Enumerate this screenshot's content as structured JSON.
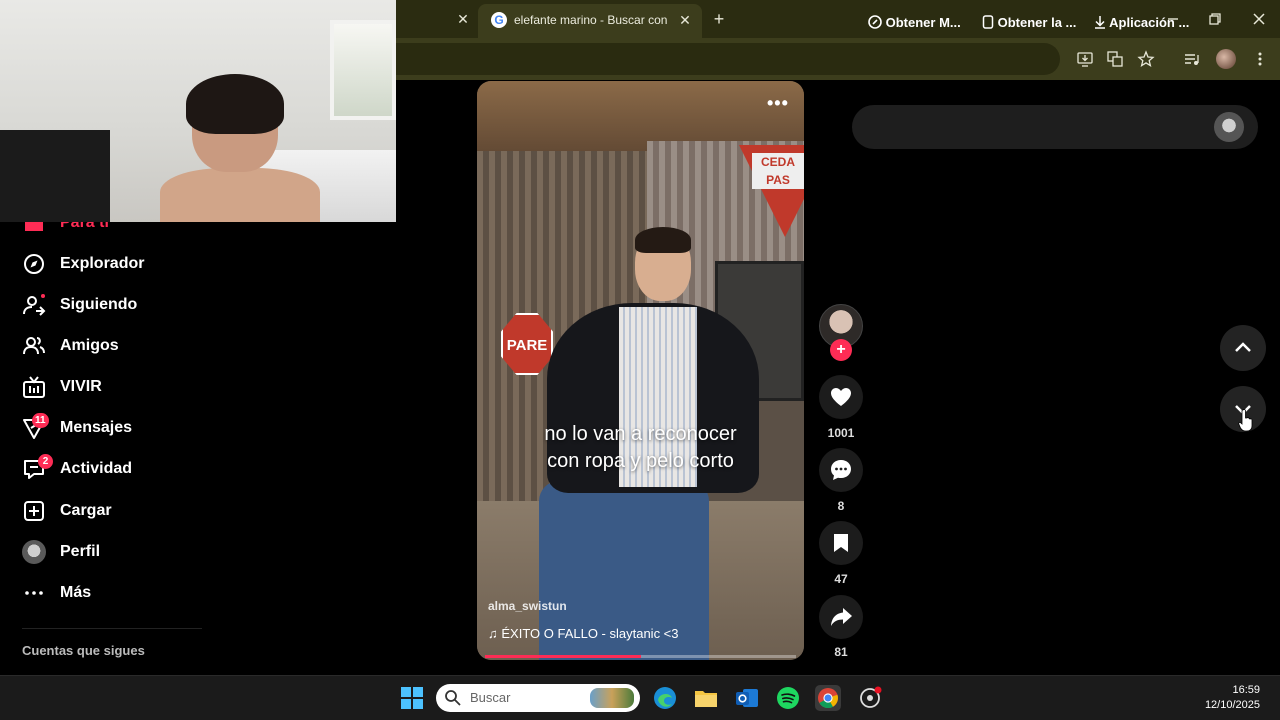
{
  "browser": {
    "tab_title": "elefante marino - Buscar con Google",
    "tab_favicon": "G",
    "close_glyph": "✕",
    "new_tab_glyph": "+"
  },
  "sidebar": {
    "items": [
      {
        "label": "Para ti",
        "icon": "home-icon"
      },
      {
        "label": "Explorador",
        "icon": "compass-icon"
      },
      {
        "label": "Siguiendo",
        "icon": "following-icon"
      },
      {
        "label": "Amigos",
        "icon": "friends-icon"
      },
      {
        "label": "VIVIR",
        "icon": "live-icon"
      },
      {
        "label": "Mensajes",
        "icon": "messages-icon",
        "badge": "11"
      },
      {
        "label": "Actividad",
        "icon": "activity-icon",
        "badge": "2"
      },
      {
        "label": "Cargar",
        "icon": "upload-icon"
      },
      {
        "label": "Perfil",
        "icon": "profile-icon"
      },
      {
        "label": "Más",
        "icon": "more-icon"
      }
    ],
    "following_heading": "Cuentas que sigues"
  },
  "video": {
    "caption_line1": "no lo van a reconocer",
    "caption_line2": "con ropa y pelo corto",
    "author": "alma_swistun",
    "music": "♫  ÉXITO O FALLO - slaytanic <3",
    "progress": 0.5,
    "stop_sign": "PARE",
    "yield_sign": "CEDA PAS",
    "more_glyph": "•••"
  },
  "actions": {
    "likes": "1001",
    "comments": "8",
    "saves": "47",
    "shares": "81",
    "follow_glyph": "+"
  },
  "top_pill": {
    "item1": "Obtener M...",
    "item2": "Obtener la ...",
    "item3": "Aplicación ..."
  },
  "taskbar": {
    "search_label": "Buscar",
    "time": "16:59",
    "date": "12/10/2025"
  },
  "colors": {
    "accent": "#fe2c55",
    "chrome_frame": "#2b2c11"
  }
}
